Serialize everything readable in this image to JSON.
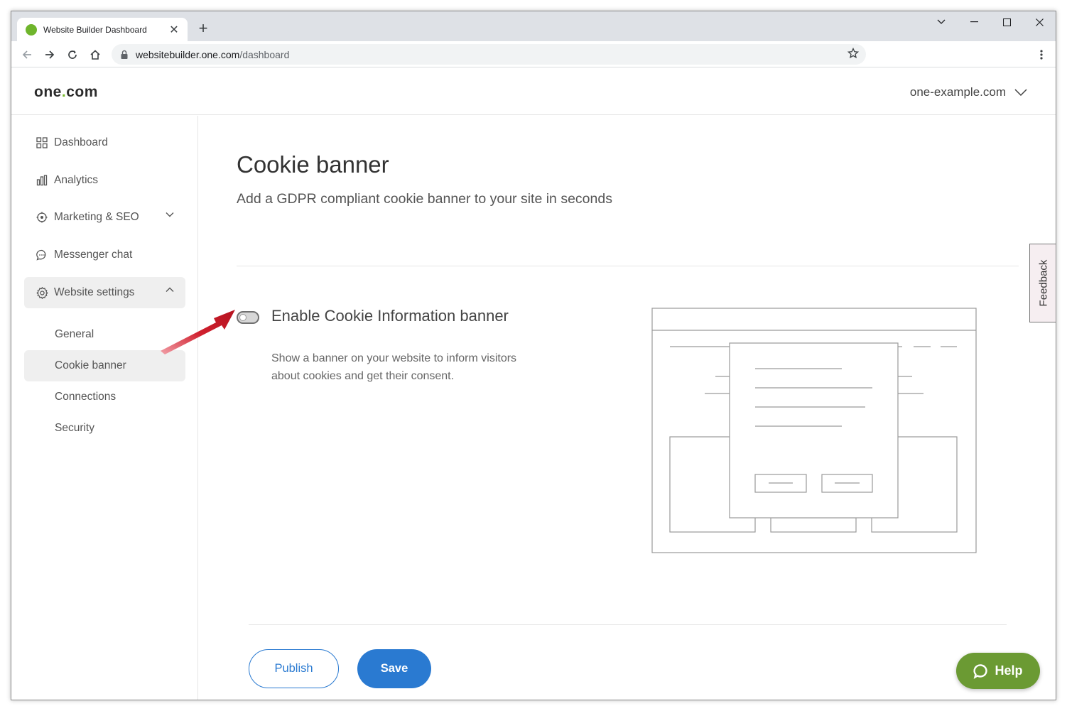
{
  "browser": {
    "tab_title": "Website Builder Dashboard",
    "url_host": "websitebuilder.one.com",
    "url_path": "/dashboard"
  },
  "header": {
    "logo_prefix": "one",
    "logo_dot": ".",
    "logo_suffix": "com",
    "domain": "one-example.com"
  },
  "sidebar": {
    "items": [
      {
        "label": "Dashboard",
        "icon": "grid-icon"
      },
      {
        "label": "Analytics",
        "icon": "bar-chart-icon"
      },
      {
        "label": "Marketing & SEO",
        "icon": "target-icon"
      },
      {
        "label": "Messenger chat",
        "icon": "chat-bubble-icon"
      },
      {
        "label": "Website settings",
        "icon": "gear-icon"
      }
    ],
    "subitems": [
      {
        "label": "General"
      },
      {
        "label": "Cookie banner"
      },
      {
        "label": "Connections"
      },
      {
        "label": "Security"
      }
    ]
  },
  "main": {
    "title": "Cookie banner",
    "subtitle": "Add a GDPR compliant cookie banner to your site in seconds",
    "setting": {
      "title": "Enable Cookie Information banner",
      "description": "Show a banner on your website to inform visitors about cookies and get their consent.",
      "enabled": false
    },
    "publish_label": "Publish",
    "save_label": "Save"
  },
  "feedback_label": "Feedback",
  "help_label": "Help",
  "colors": {
    "brand_green": "#76b82a",
    "primary_blue": "#2a7ad1",
    "help_green": "#6b9a33",
    "annotation_red": "#d0202e"
  }
}
